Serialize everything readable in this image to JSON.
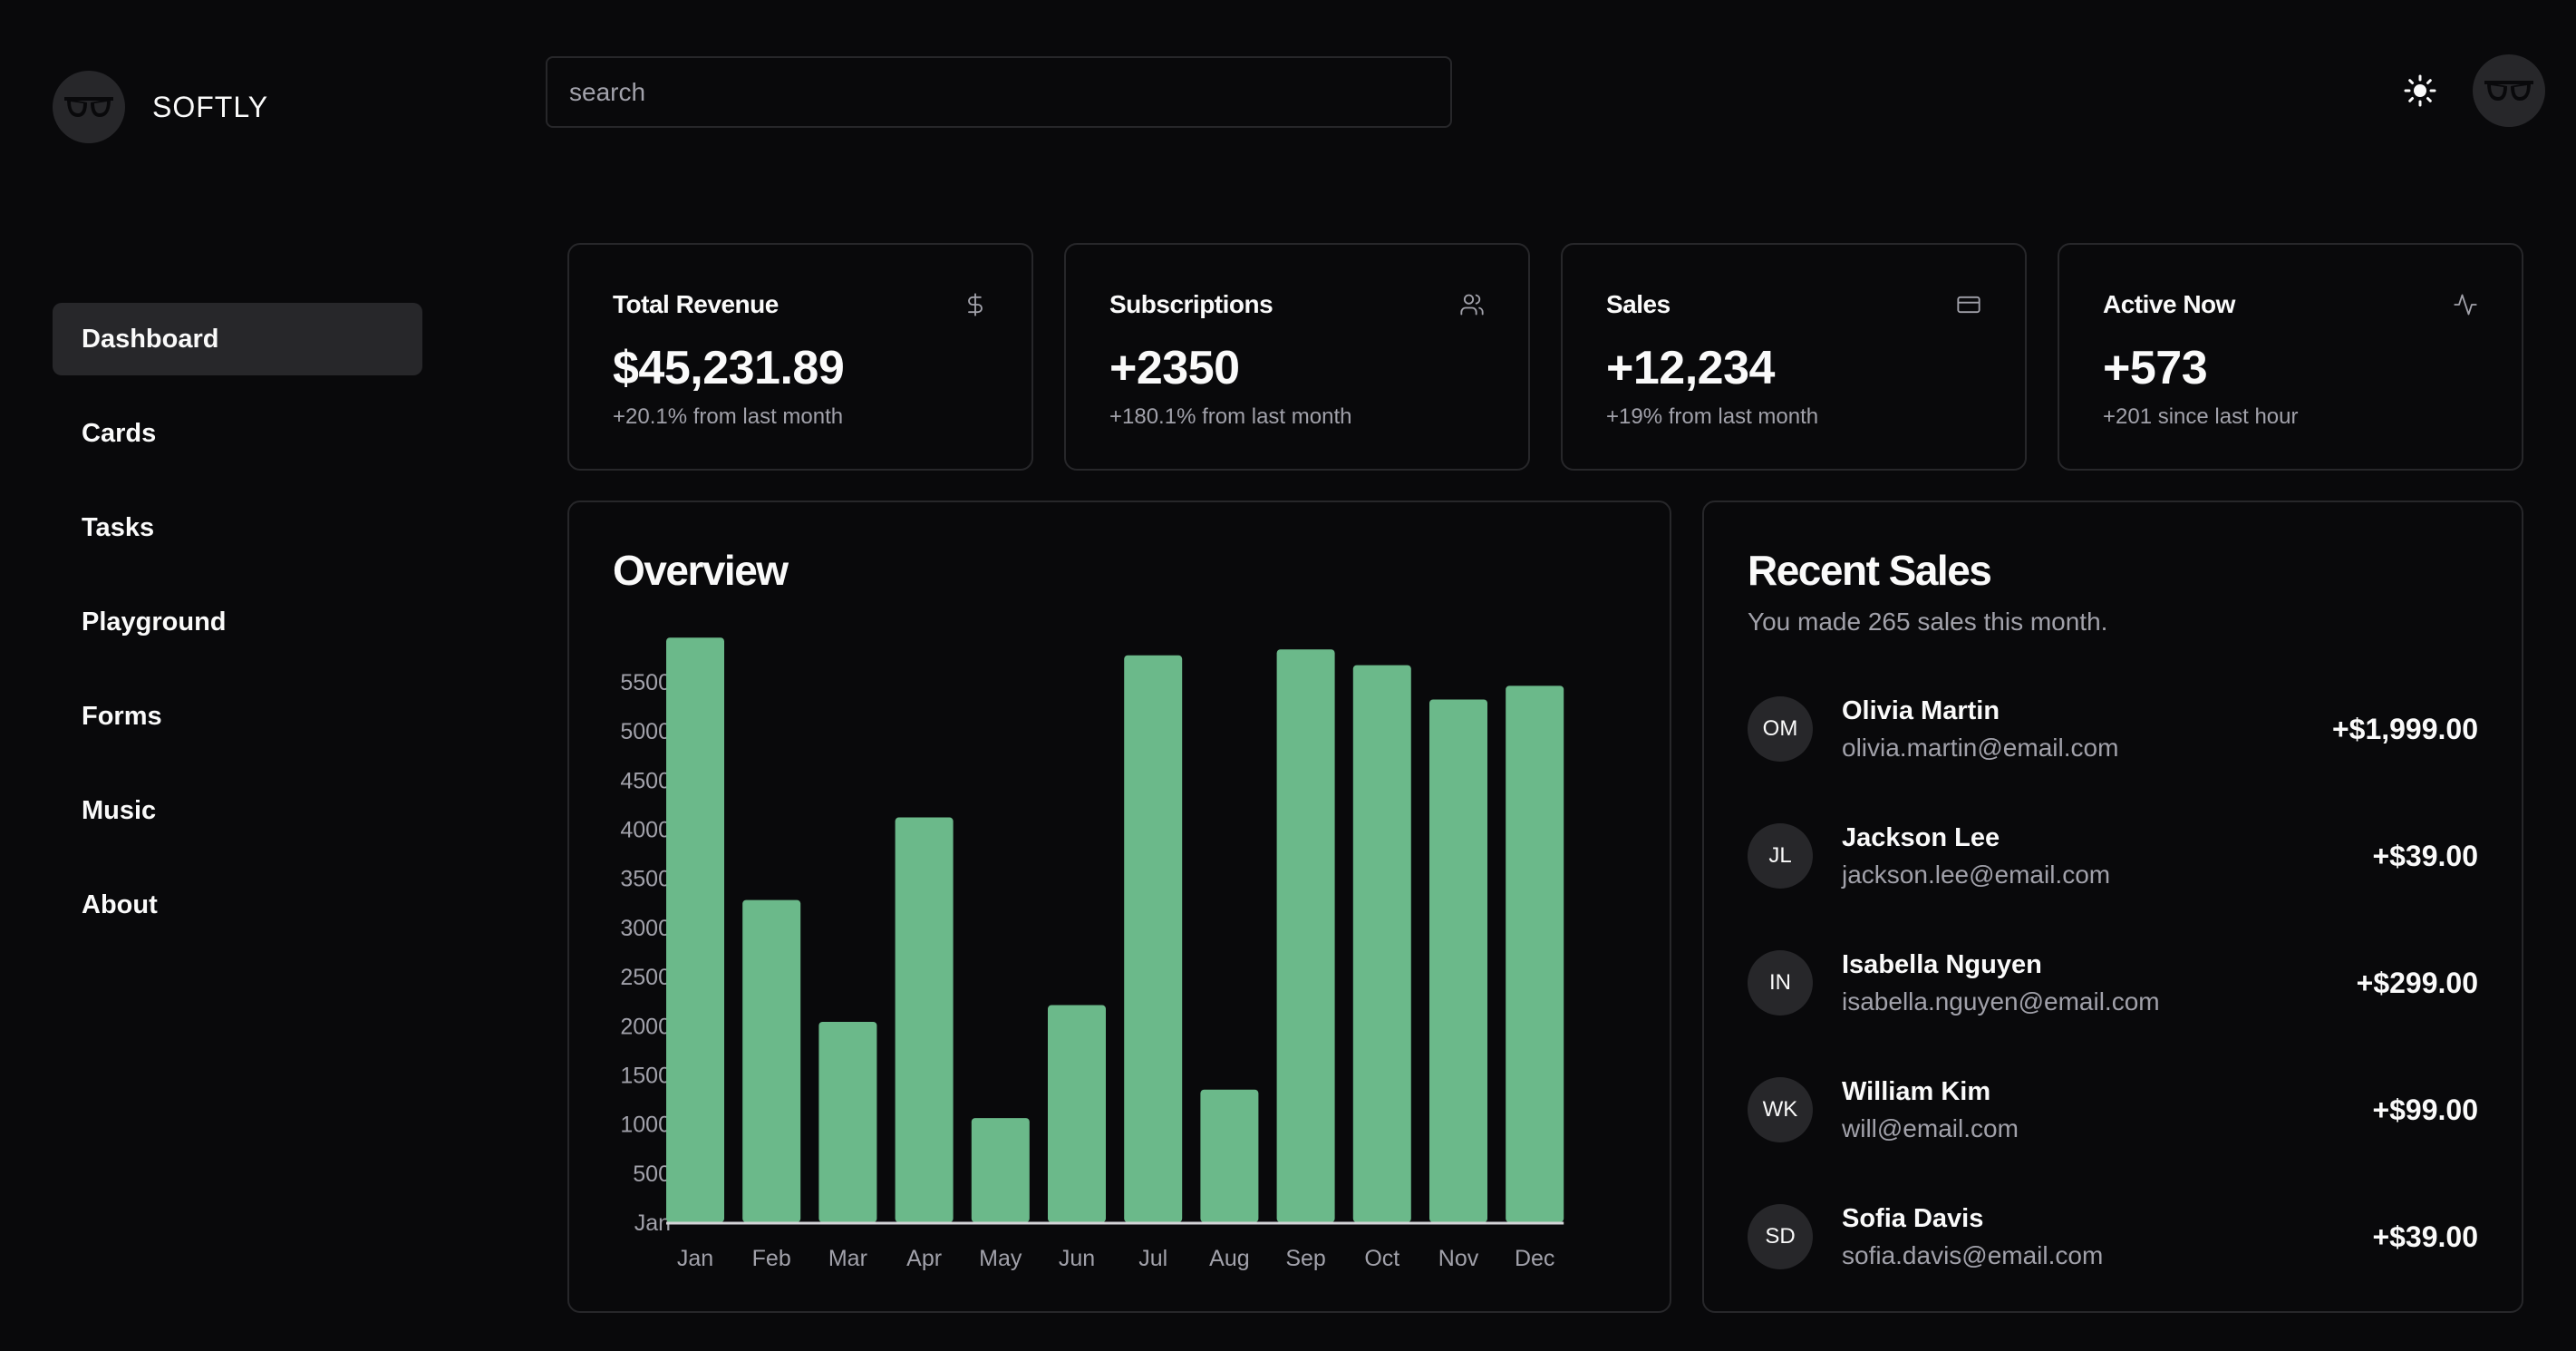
{
  "app": {
    "brand": "SOFTLY"
  },
  "search": {
    "placeholder": "search"
  },
  "sidebar": {
    "items": [
      {
        "label": "Dashboard",
        "active": true
      },
      {
        "label": "Cards"
      },
      {
        "label": "Tasks"
      },
      {
        "label": "Playground"
      },
      {
        "label": "Forms"
      },
      {
        "label": "Music"
      },
      {
        "label": "About"
      }
    ]
  },
  "stats": [
    {
      "title": "Total Revenue",
      "value": "$45,231.89",
      "sub": "+20.1% from last month",
      "icon": "dollar-icon"
    },
    {
      "title": "Subscriptions",
      "value": "+2350",
      "sub": "+180.1% from last month",
      "icon": "users-icon"
    },
    {
      "title": "Sales",
      "value": "+12,234",
      "sub": "+19% from last month",
      "icon": "credit-card-icon"
    },
    {
      "title": "Active Now",
      "value": "+573",
      "sub": "+201 since last hour",
      "icon": "activity-icon"
    }
  ],
  "overview": {
    "title": "Overview"
  },
  "chart_data": {
    "type": "bar",
    "title": "",
    "xlabel": "",
    "ylabel": "",
    "categories": [
      "Jan",
      "Feb",
      "Mar",
      "Apr",
      "May",
      "Jun",
      "Jul",
      "Aug",
      "Sep",
      "Oct",
      "Nov",
      "Dec"
    ],
    "values": [
      5950,
      3280,
      2040,
      4120,
      1060,
      2210,
      5770,
      1350,
      5830,
      5670,
      5320,
      5460
    ],
    "ylim": [
      0,
      5500
    ],
    "yticks": [
      "Jan",
      "500",
      "1000",
      "1500",
      "2000",
      "2500",
      "3000",
      "3500",
      "4000",
      "4500",
      "5000",
      "5500"
    ],
    "grid": false,
    "bar_color": "#6bb98a"
  },
  "recent_sales": {
    "title": "Recent Sales",
    "subtitle": "You made 265 sales this month.",
    "items": [
      {
        "initials": "OM",
        "name": "Olivia Martin",
        "email": "olivia.martin@email.com",
        "amount": "+$1,999.00"
      },
      {
        "initials": "JL",
        "name": "Jackson Lee",
        "email": "jackson.lee@email.com",
        "amount": "+$39.00"
      },
      {
        "initials": "IN",
        "name": "Isabella Nguyen",
        "email": "isabella.nguyen@email.com",
        "amount": "+$299.00"
      },
      {
        "initials": "WK",
        "name": "William Kim",
        "email": "will@email.com",
        "amount": "+$99.00"
      },
      {
        "initials": "SD",
        "name": "Sofia Davis",
        "email": "sofia.davis@email.com",
        "amount": "+$39.00"
      }
    ]
  },
  "colors": {
    "background": "#09090b",
    "border": "#27272a",
    "muted": "#a1a1aa",
    "accent": "#6bb98a"
  }
}
